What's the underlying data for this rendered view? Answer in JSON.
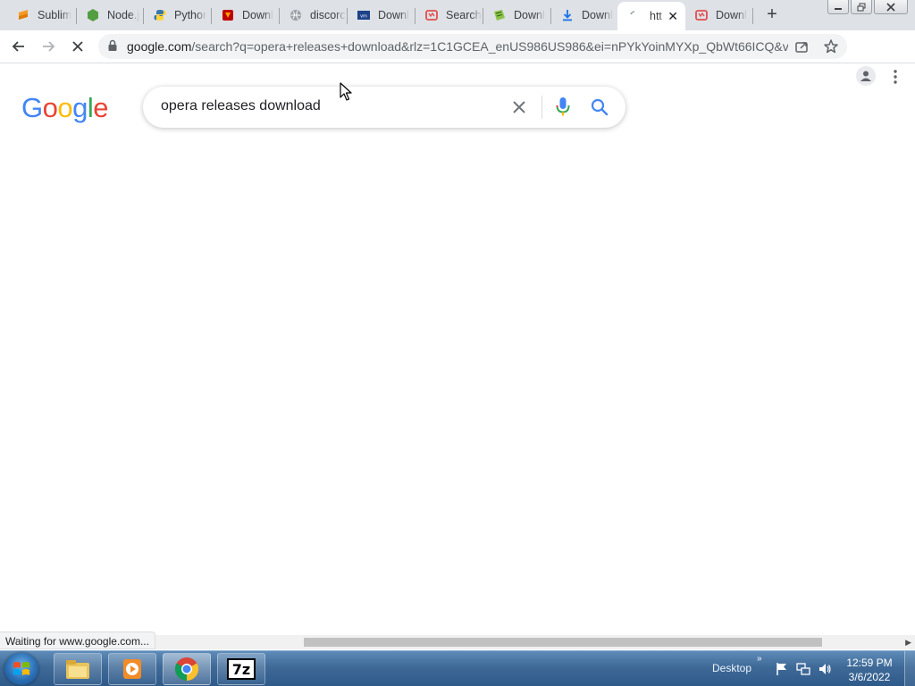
{
  "browser": {
    "tabs": [
      {
        "label": "Sublim",
        "icon": "sublime-text-icon"
      },
      {
        "label": "Node.j",
        "icon": "nodejs-icon"
      },
      {
        "label": "Pythor",
        "icon": "python-icon"
      },
      {
        "label": "Downl",
        "icon": "filezilla-icon"
      },
      {
        "label": "discorc",
        "icon": "globe-icon"
      },
      {
        "label": "Downl",
        "icon": "vmware-icon"
      },
      {
        "label": "Search",
        "icon": "search-tab-icon"
      },
      {
        "label": "Downl",
        "icon": "notepadpp-icon"
      },
      {
        "label": "Downl",
        "icon": "download-icon"
      },
      {
        "label": "htt",
        "icon": "loading-spinner-icon",
        "active": true
      },
      {
        "label": "Downl",
        "icon": "search-tab-icon"
      }
    ],
    "new_tab_label": "+",
    "address_host": "google.com",
    "address_rest": "/search?q=opera+releases+download&rlz=1C1GCEA_enUS986US986&ei=nPYkYoinMYXp_QbWt66ICQ&v...",
    "status_text": "Waiting for www.google.com..."
  },
  "page": {
    "logo_letters": [
      {
        "ch": "G",
        "color": "#4285F4"
      },
      {
        "ch": "o",
        "color": "#EA4335"
      },
      {
        "ch": "o",
        "color": "#FBBC05"
      },
      {
        "ch": "g",
        "color": "#4285F4"
      },
      {
        "ch": "l",
        "color": "#34A853"
      },
      {
        "ch": "e",
        "color": "#EA4335"
      }
    ],
    "search_query": "opera releases download"
  },
  "taskbar": {
    "apps": [
      "explorer-icon",
      "media-player-icon",
      "chrome-icon",
      "7zip-icon"
    ],
    "zip_label": "7z",
    "desktop_label": "Desktop",
    "clock_time": "12:59 PM",
    "clock_date": "3/6/2022"
  },
  "colors": {
    "accent_blue": "#4285F4",
    "chrome_tabstrip": "#dee1e6",
    "taskbar_blue": "#3f6a98"
  }
}
